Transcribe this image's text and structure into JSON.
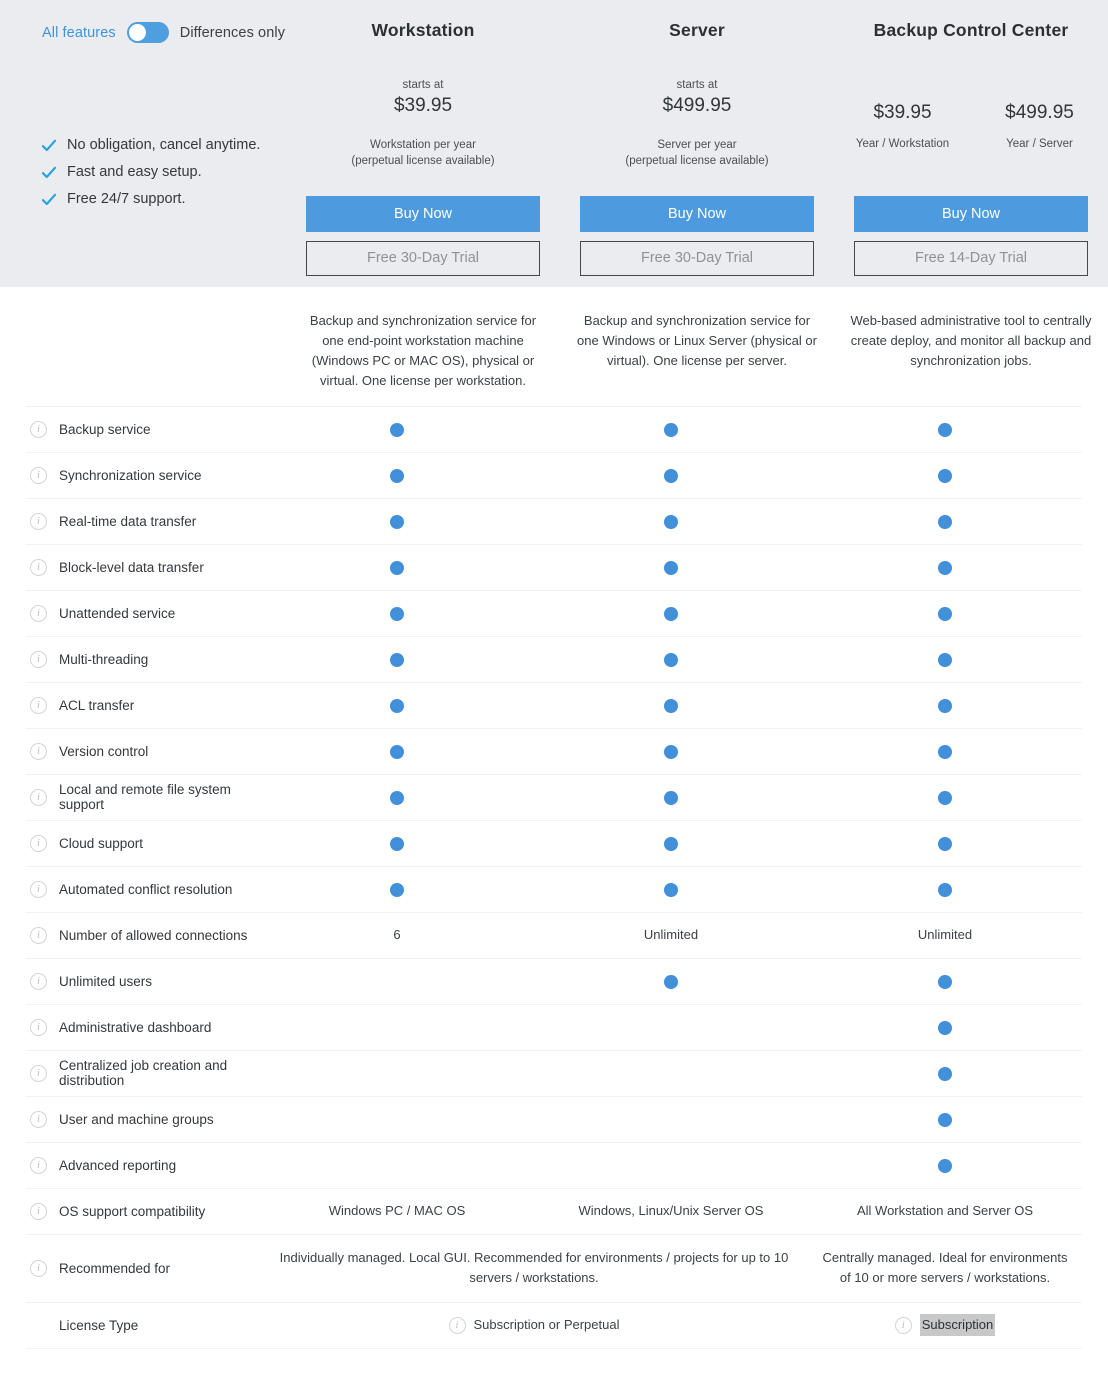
{
  "colors": {
    "accent_blue": "#4e9ade",
    "dot_blue": "#4190d9",
    "check_blue": "#29a3e0",
    "band_bg": "#ebecf0",
    "highlight": "#c8c8c8"
  },
  "toggle": {
    "left_label": "All features",
    "right_label": "Differences only",
    "state": "All features"
  },
  "benefits": [
    "No obligation, cancel anytime.",
    "Fast and easy setup.",
    "Free 24/7 support."
  ],
  "plans": [
    {
      "title": "Workstation",
      "starts_at": "starts at",
      "price": "$39.95",
      "note_line1": "Workstation per year",
      "note_line2": "(perpetual license available)",
      "buy_label": "Buy Now",
      "trial_label": "Free 30-Day Trial",
      "description": "Backup and synchronization service for one end-point workstation machine (Windows PC or MAC OS), physical or virtual. One license per workstation."
    },
    {
      "title": "Server",
      "starts_at": "starts at",
      "price": "$499.95",
      "note_line1": "Server per year",
      "note_line2": "(perpetual license available)",
      "buy_label": "Buy Now",
      "trial_label": "Free 30-Day Trial",
      "description": "Backup and synchronization service for one Windows or Linux Server (physical or virtual). One license per server."
    },
    {
      "title": "Backup Control Center",
      "price_left": "$39.95",
      "price_right": "$499.95",
      "note_left": "Year / Workstation",
      "note_right": "Year / Server",
      "buy_label": "Buy Now",
      "trial_label": "Free 14-Day Trial",
      "description": "Web-based administrative tool to centrally create deploy, and monitor all backup and synchronization jobs."
    }
  ],
  "features": [
    {
      "label": "Backup service",
      "workstation": "dot",
      "server": "dot",
      "bcc": "dot"
    },
    {
      "label": "Synchronization service",
      "workstation": "dot",
      "server": "dot",
      "bcc": "dot"
    },
    {
      "label": "Real-time data transfer",
      "workstation": "dot",
      "server": "dot",
      "bcc": "dot"
    },
    {
      "label": "Block-level data transfer",
      "workstation": "dot",
      "server": "dot",
      "bcc": "dot"
    },
    {
      "label": "Unattended service",
      "workstation": "dot",
      "server": "dot",
      "bcc": "dot"
    },
    {
      "label": "Multi-threading",
      "workstation": "dot",
      "server": "dot",
      "bcc": "dot"
    },
    {
      "label": "ACL transfer",
      "workstation": "dot",
      "server": "dot",
      "bcc": "dot"
    },
    {
      "label": "Version control",
      "workstation": "dot",
      "server": "dot",
      "bcc": "dot"
    },
    {
      "label": "Local and remote file system support",
      "workstation": "dot",
      "server": "dot",
      "bcc": "dot"
    },
    {
      "label": "Cloud support",
      "workstation": "dot",
      "server": "dot",
      "bcc": "dot"
    },
    {
      "label": "Automated conflict resolution",
      "workstation": "dot",
      "server": "dot",
      "bcc": "dot"
    },
    {
      "label": "Number of allowed connections",
      "workstation": "6",
      "server": "Unlimited",
      "bcc": "Unlimited"
    },
    {
      "label": "Unlimited users",
      "workstation": "",
      "server": "dot",
      "bcc": "dot"
    },
    {
      "label": "Administrative dashboard",
      "workstation": "",
      "server": "",
      "bcc": "dot"
    },
    {
      "label": "Centralized job creation and distribution",
      "workstation": "",
      "server": "",
      "bcc": "dot"
    },
    {
      "label": "User and machine groups",
      "workstation": "",
      "server": "",
      "bcc": "dot"
    },
    {
      "label": "Advanced reporting",
      "workstation": "",
      "server": "",
      "bcc": "dot"
    },
    {
      "label": "OS support compatibility",
      "workstation": "Windows PC / MAC OS",
      "server": "Windows, Linux/Unix Server OS",
      "bcc": "All Workstation and Server OS"
    },
    {
      "label": "Recommended for",
      "tall": true,
      "span_first_two": "Individually managed. Local GUI. Recommended for environments / projects for up to 10 servers / workstations.",
      "bcc": "Centrally managed. Ideal for environments of 10 or more servers / workstations."
    }
  ],
  "license_row": {
    "label": "License Type",
    "merged_value": "Subscription or Perpetual",
    "bcc_value": "Subscription",
    "bcc_highlighted": true
  },
  "icons": {
    "info": "i",
    "check": "check-icon"
  }
}
